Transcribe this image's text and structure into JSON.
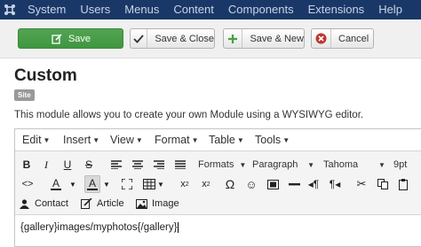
{
  "nav": {
    "logo_icon": "joomla-logo-icon",
    "items": [
      "System",
      "Users",
      "Menus",
      "Content",
      "Components",
      "Extensions",
      "Help"
    ]
  },
  "toolbar": {
    "save": "Save",
    "save_close": "Save & Close",
    "save_new": "Save & New",
    "cancel": "Cancel"
  },
  "page": {
    "title": "Custom",
    "badge": "Site",
    "description": "This module allows you to create your own Module using a WYSIWYG editor."
  },
  "editor": {
    "menus": [
      "Edit",
      "Insert",
      "View",
      "Format",
      "Table",
      "Tools"
    ],
    "formats_label": "Formats",
    "block_format": "Paragraph",
    "font_family": "Tahoma",
    "font_size": "9pt",
    "buttons": {
      "contact": "Contact",
      "article": "Article",
      "image": "Image"
    },
    "content": "{gallery}images/myphotos{/gallery}"
  },
  "colors": {
    "nav_bg": "#1a3867",
    "save_green": "#46a046",
    "cancel_red": "#bd362f"
  }
}
